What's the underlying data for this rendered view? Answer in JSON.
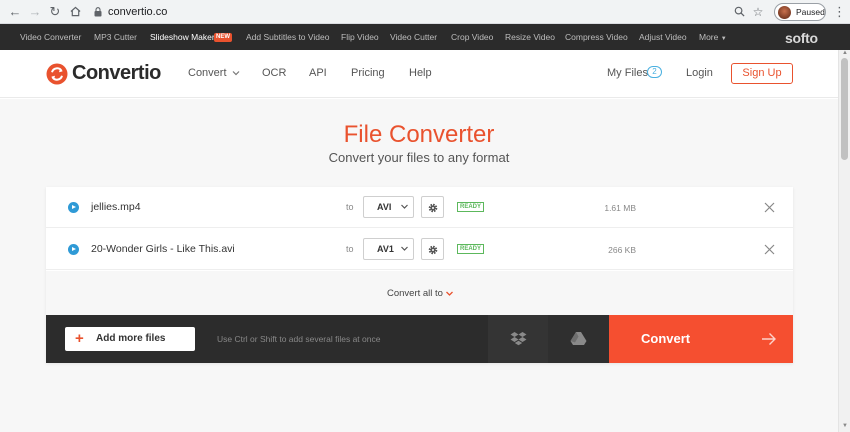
{
  "browser": {
    "url": "convertio.co",
    "profile_status": "Paused"
  },
  "tools_bar": {
    "items": [
      "Video Converter",
      "MP3 Cutter",
      "Slideshow Maker",
      "Add Subtitles to Video",
      "Flip Video",
      "Video Cutter",
      "Crop Video",
      "Resize Video",
      "Compress Video",
      "Adjust Video",
      "More"
    ],
    "new_badge": "NEW",
    "brand": "softo"
  },
  "header": {
    "logo_text": "Convertio",
    "menu": [
      "Convert",
      "OCR",
      "API",
      "Pricing",
      "Help"
    ],
    "my_files_label": "My Files",
    "my_files_count": "2",
    "login_label": "Login",
    "signup_label": "Sign Up"
  },
  "hero": {
    "title": "File Converter",
    "subtitle": "Convert your files to any format"
  },
  "files": [
    {
      "name": "jellies.mp4",
      "to_label": "to",
      "format": "AVI",
      "status": "READY",
      "size": "1.61 MB"
    },
    {
      "name": "20-Wonder Girls - Like This.avi",
      "to_label": "to",
      "format": "AV1",
      "status": "READY",
      "size": "266 KB"
    }
  ],
  "convert_all_label": "Convert all to",
  "action_bar": {
    "add_files_label": "Add more files",
    "hint": "Use Ctrl or Shift to add several files at once",
    "convert_label": "Convert"
  },
  "colors": {
    "brand": "#e9522e",
    "convert_button": "#f54f30",
    "ready": "#5cb85c",
    "play": "#2f9ad6"
  }
}
